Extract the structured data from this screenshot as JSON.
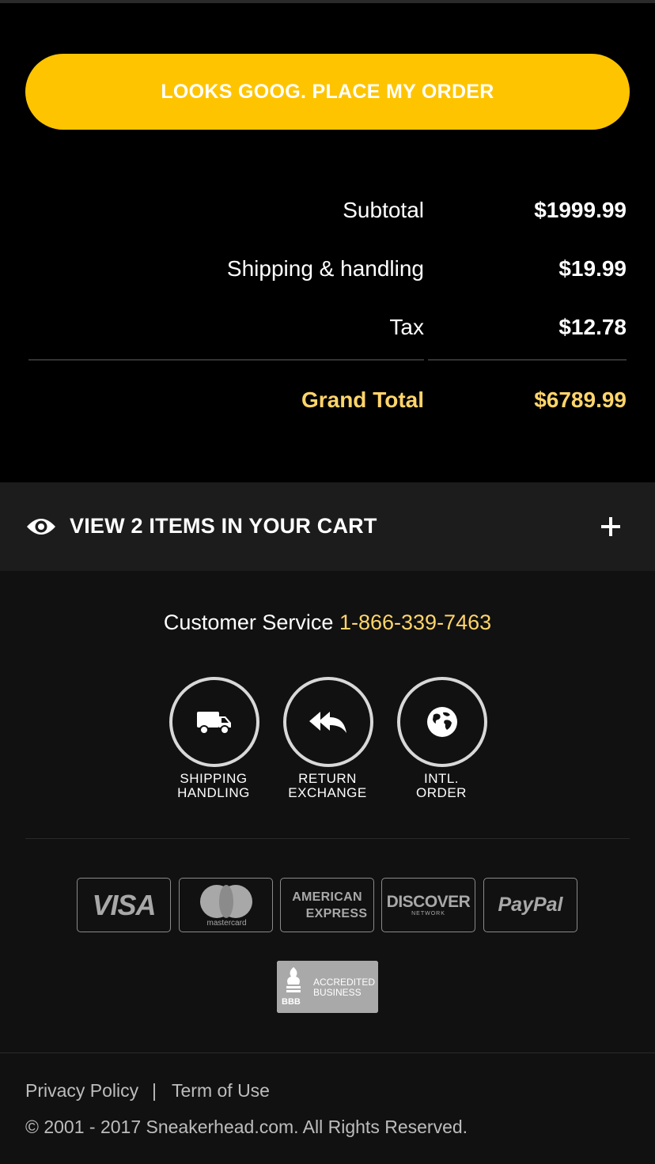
{
  "place_order_label": "LOOKS GOOG. PLACE MY ORDER",
  "summary": {
    "subtotal_label": "Subtotal",
    "subtotal_value": "$1999.99",
    "shipping_label": "Shipping & handling",
    "shipping_value": "$19.99",
    "tax_label": "Tax",
    "tax_value": "$12.78",
    "grand_total_label": "Grand Total",
    "grand_total_value": "$6789.99"
  },
  "cart": {
    "label": "VIEW 2 ITEMS IN YOUR CART",
    "icon": "eye-icon",
    "toggle_icon": "plus-icon"
  },
  "customer_service": {
    "label": "Customer Service",
    "phone": "1-866-339-7463"
  },
  "services": [
    {
      "icon": "truck-icon",
      "line1": "SHIPPING",
      "line2": "HANDLING"
    },
    {
      "icon": "reply-all-icon",
      "line1": "RETURN",
      "line2": "EXCHANGE"
    },
    {
      "icon": "globe-icon",
      "line1": "INTL.",
      "line2": "ORDER"
    }
  ],
  "payment_methods": {
    "visa": "VISA",
    "mastercard": "mastercard",
    "amex_line1": "AMERICAN",
    "amex_line2": "EXPRESS",
    "discover": "DISCOVER",
    "discover_sub": "NETWORK",
    "paypal": "PayPal"
  },
  "bbb": {
    "mark": "BBB",
    "line1": "ACCREDITED",
    "line2": "BUSINESS"
  },
  "footer": {
    "privacy_label": "Privacy Policy",
    "separator": "|",
    "terms_label": "Term of Use",
    "copyright": "© 2001 - 2017 Sneakerhead.com. All Rights Reserved."
  },
  "colors": {
    "accent": "#FFC400",
    "highlight": "#FFD56B",
    "background_top": "#000000",
    "background": "#111111",
    "cart_bar": "#1c1c1c"
  }
}
